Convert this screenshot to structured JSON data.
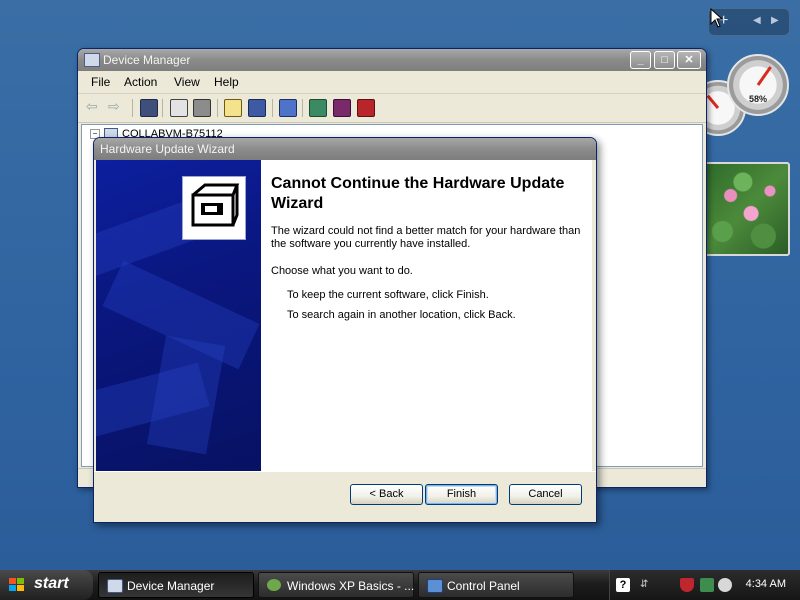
{
  "device_manager": {
    "title": "Device Manager",
    "menu": [
      "File",
      "Action",
      "View",
      "Help"
    ],
    "tree_root": "COLLABVM-B75112"
  },
  "wizard": {
    "title": "Hardware Update Wizard",
    "heading": "Cannot Continue the Hardware Update Wizard",
    "message": "The wizard could not find a better match for your hardware than the software you currently have installed.",
    "prompt": "Choose what you want to do.",
    "option_finish": "To keep the current software, click Finish.",
    "option_back": "To search again in another location, click Back.",
    "buttons": {
      "back": "< Back",
      "finish": "Finish",
      "cancel": "Cancel"
    }
  },
  "gadgets": {
    "cpu_meter": "58%"
  },
  "taskbar": {
    "start_label": "start",
    "tasks": [
      "Device Manager",
      "Windows XP Basics - ...",
      "Control Panel"
    ],
    "clock": "4:34 AM"
  }
}
